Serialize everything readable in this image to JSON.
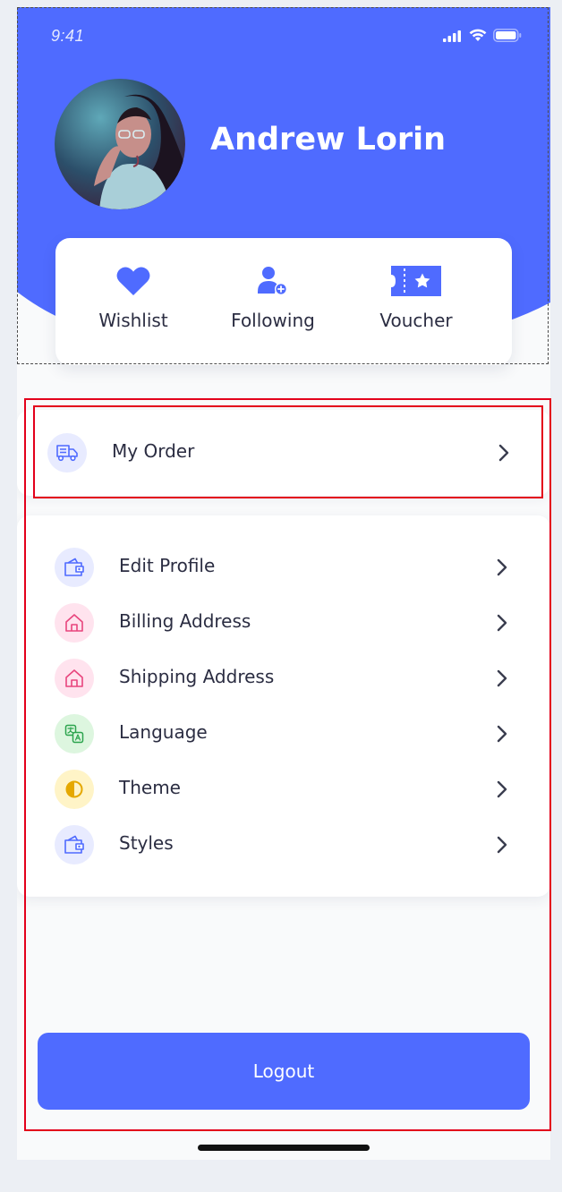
{
  "status_bar": {
    "time": "9:41"
  },
  "profile": {
    "name": "Andrew Lorin",
    "avatar_icon": "user-photo"
  },
  "quick_actions": [
    {
      "label": "Wishlist",
      "icon": "heart-icon"
    },
    {
      "label": "Following",
      "icon": "user-add-icon"
    },
    {
      "label": "Voucher",
      "icon": "ticket-icon"
    }
  ],
  "order": {
    "label": "My Order",
    "icon": "truck-icon"
  },
  "menu": [
    {
      "label": "Edit Profile",
      "icon": "wallet-icon"
    },
    {
      "label": "Billing Address",
      "icon": "home-icon"
    },
    {
      "label": "Shipping Address",
      "icon": "home-icon"
    },
    {
      "label": "Language",
      "icon": "translate-icon"
    },
    {
      "label": "Theme",
      "icon": "contrast-icon"
    },
    {
      "label": "Styles",
      "icon": "wallet-icon"
    }
  ],
  "logout": {
    "label": "Logout"
  },
  "colors": {
    "primary": "#4f6bff",
    "icon_bg_blue": "#e8ebff",
    "icon_bg_pink": "#ffe3ee",
    "icon_bg_green": "#ddf6df",
    "icon_bg_yellow": "#fff4c7",
    "annotation_red": "#e3001b"
  }
}
